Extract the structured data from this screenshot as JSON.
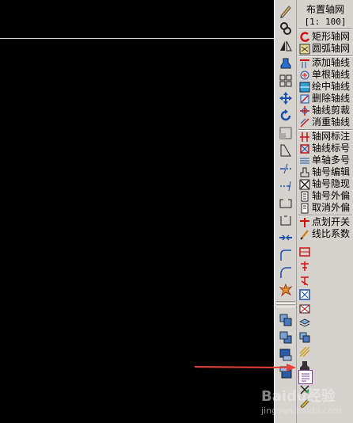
{
  "panel": {
    "title": "布置轴网",
    "scale": "[1: 100]",
    "items": [
      {
        "label": "矩形轴网",
        "icon": "rect-grid-icon"
      },
      {
        "label": "圆弧轴网",
        "icon": "arc-grid-icon"
      },
      {
        "label": "添加轴线",
        "icon": "add-axis-icon"
      },
      {
        "label": "单根轴线",
        "icon": "single-axis-icon"
      },
      {
        "label": "绘中轴线",
        "icon": "center-axis-icon"
      },
      {
        "label": "删除轴线",
        "icon": "delete-axis-icon"
      },
      {
        "label": "轴线剪裁",
        "icon": "trim-axis-icon"
      },
      {
        "label": "消重轴线",
        "icon": "dedupe-axis-icon"
      },
      {
        "label": "轴网标注",
        "icon": "grid-dimension-icon"
      },
      {
        "label": "轴线标号",
        "icon": "axis-number-icon"
      },
      {
        "label": "单轴多号",
        "icon": "multi-number-icon"
      },
      {
        "label": "轴号编辑",
        "icon": "edit-number-icon"
      },
      {
        "label": "轴号隐现",
        "icon": "toggle-number-icon"
      },
      {
        "label": "轴号外偏",
        "icon": "offset-number-icon"
      },
      {
        "label": "取消外偏",
        "icon": "cancel-offset-icon"
      },
      {
        "label": "点划开关",
        "icon": "dash-toggle-icon"
      },
      {
        "label": "线比系数",
        "icon": "line-scale-icon"
      }
    ]
  },
  "toolbar": {
    "tools": [
      "pencil-icon",
      "link-icon",
      "mirror-icon",
      "stamp-icon",
      "array-icon",
      "move-icon",
      "rotate-icon",
      "scale-icon",
      "stretch-icon",
      "trim-icon",
      "extend-icon",
      "break-icon",
      "break-point-icon",
      "join-icon",
      "fillet-icon",
      "chamfer-icon",
      "explode-icon",
      "layer-front-icon",
      "layer-back-icon",
      "layer-above-icon",
      "layer-below-icon"
    ]
  },
  "watermark": {
    "main": "Baidu经验",
    "sub": "jingyan.baidu.com"
  },
  "colors": {
    "canvas": "#000000",
    "panel": "#d6d3ce",
    "icon_red": "#d01010",
    "icon_blue": "#1a4fa8",
    "arrow": "#e8403a"
  }
}
